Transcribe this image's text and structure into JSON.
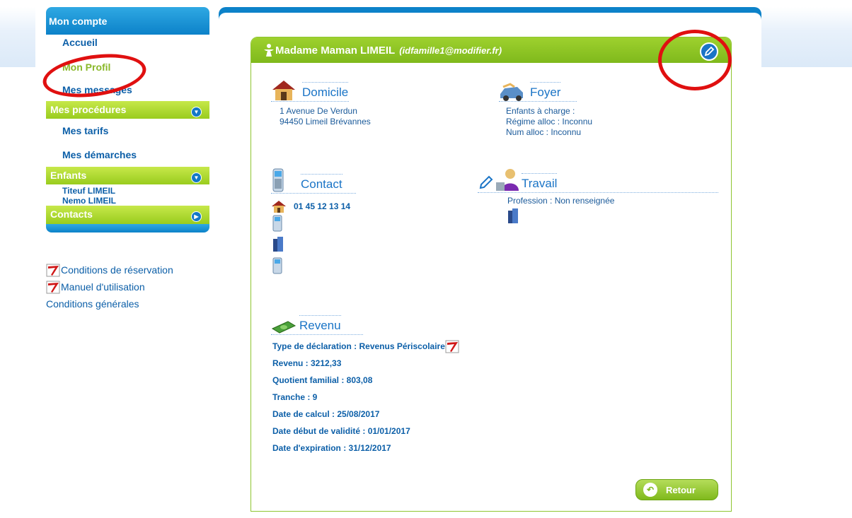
{
  "sidebar": {
    "header": "Mon compte",
    "accueil": "Accueil",
    "profil": "Mon Profil",
    "messages": "Mes messages",
    "procedures": "Mes procédures",
    "tarifs": "Mes tarifs",
    "demarches": "Mes démarches",
    "enfants": "Enfants",
    "children": [
      "Titeuf LIMEIL",
      "Nemo LIMEIL"
    ],
    "contacts": "Contacts"
  },
  "documents": {
    "reservation": "Conditions de réservation",
    "manuel": "Manuel d'utilisation",
    "generales": "Conditions générales"
  },
  "profile": {
    "name": "Madame Maman LIMEIL",
    "email": "(idfamille1@modifier.fr)"
  },
  "domicile": {
    "title": "Domicile",
    "line1": "1 Avenue De Verdun",
    "line2": "94450 Limeil Brévannes"
  },
  "foyer": {
    "title": "Foyer",
    "line1": "Enfants à charge :",
    "line2": "Régime alloc : Inconnu",
    "line3": "Num alloc : Inconnu"
  },
  "contact": {
    "title": "Contact",
    "phone": "01 45 12 13 14"
  },
  "travail": {
    "title": "Travail",
    "profession": "Profession : Non renseignée"
  },
  "revenu": {
    "title": "Revenu",
    "type": "Type de déclaration : Revenus Périscolaire",
    "revenu": "Revenu : 3212,33",
    "quotient": "Quotient familial : 803,08",
    "tranche": "Tranche : 9",
    "date_calcul": "Date de calcul : 25/08/2017",
    "date_debut": "Date début de validité : 01/01/2017",
    "date_expiration": "Date d'expiration : 31/12/2017"
  },
  "buttons": {
    "retour": "Retour"
  },
  "colors": {
    "blue": "#0c82c9",
    "green": "#8ec530",
    "red": "#e01010"
  }
}
